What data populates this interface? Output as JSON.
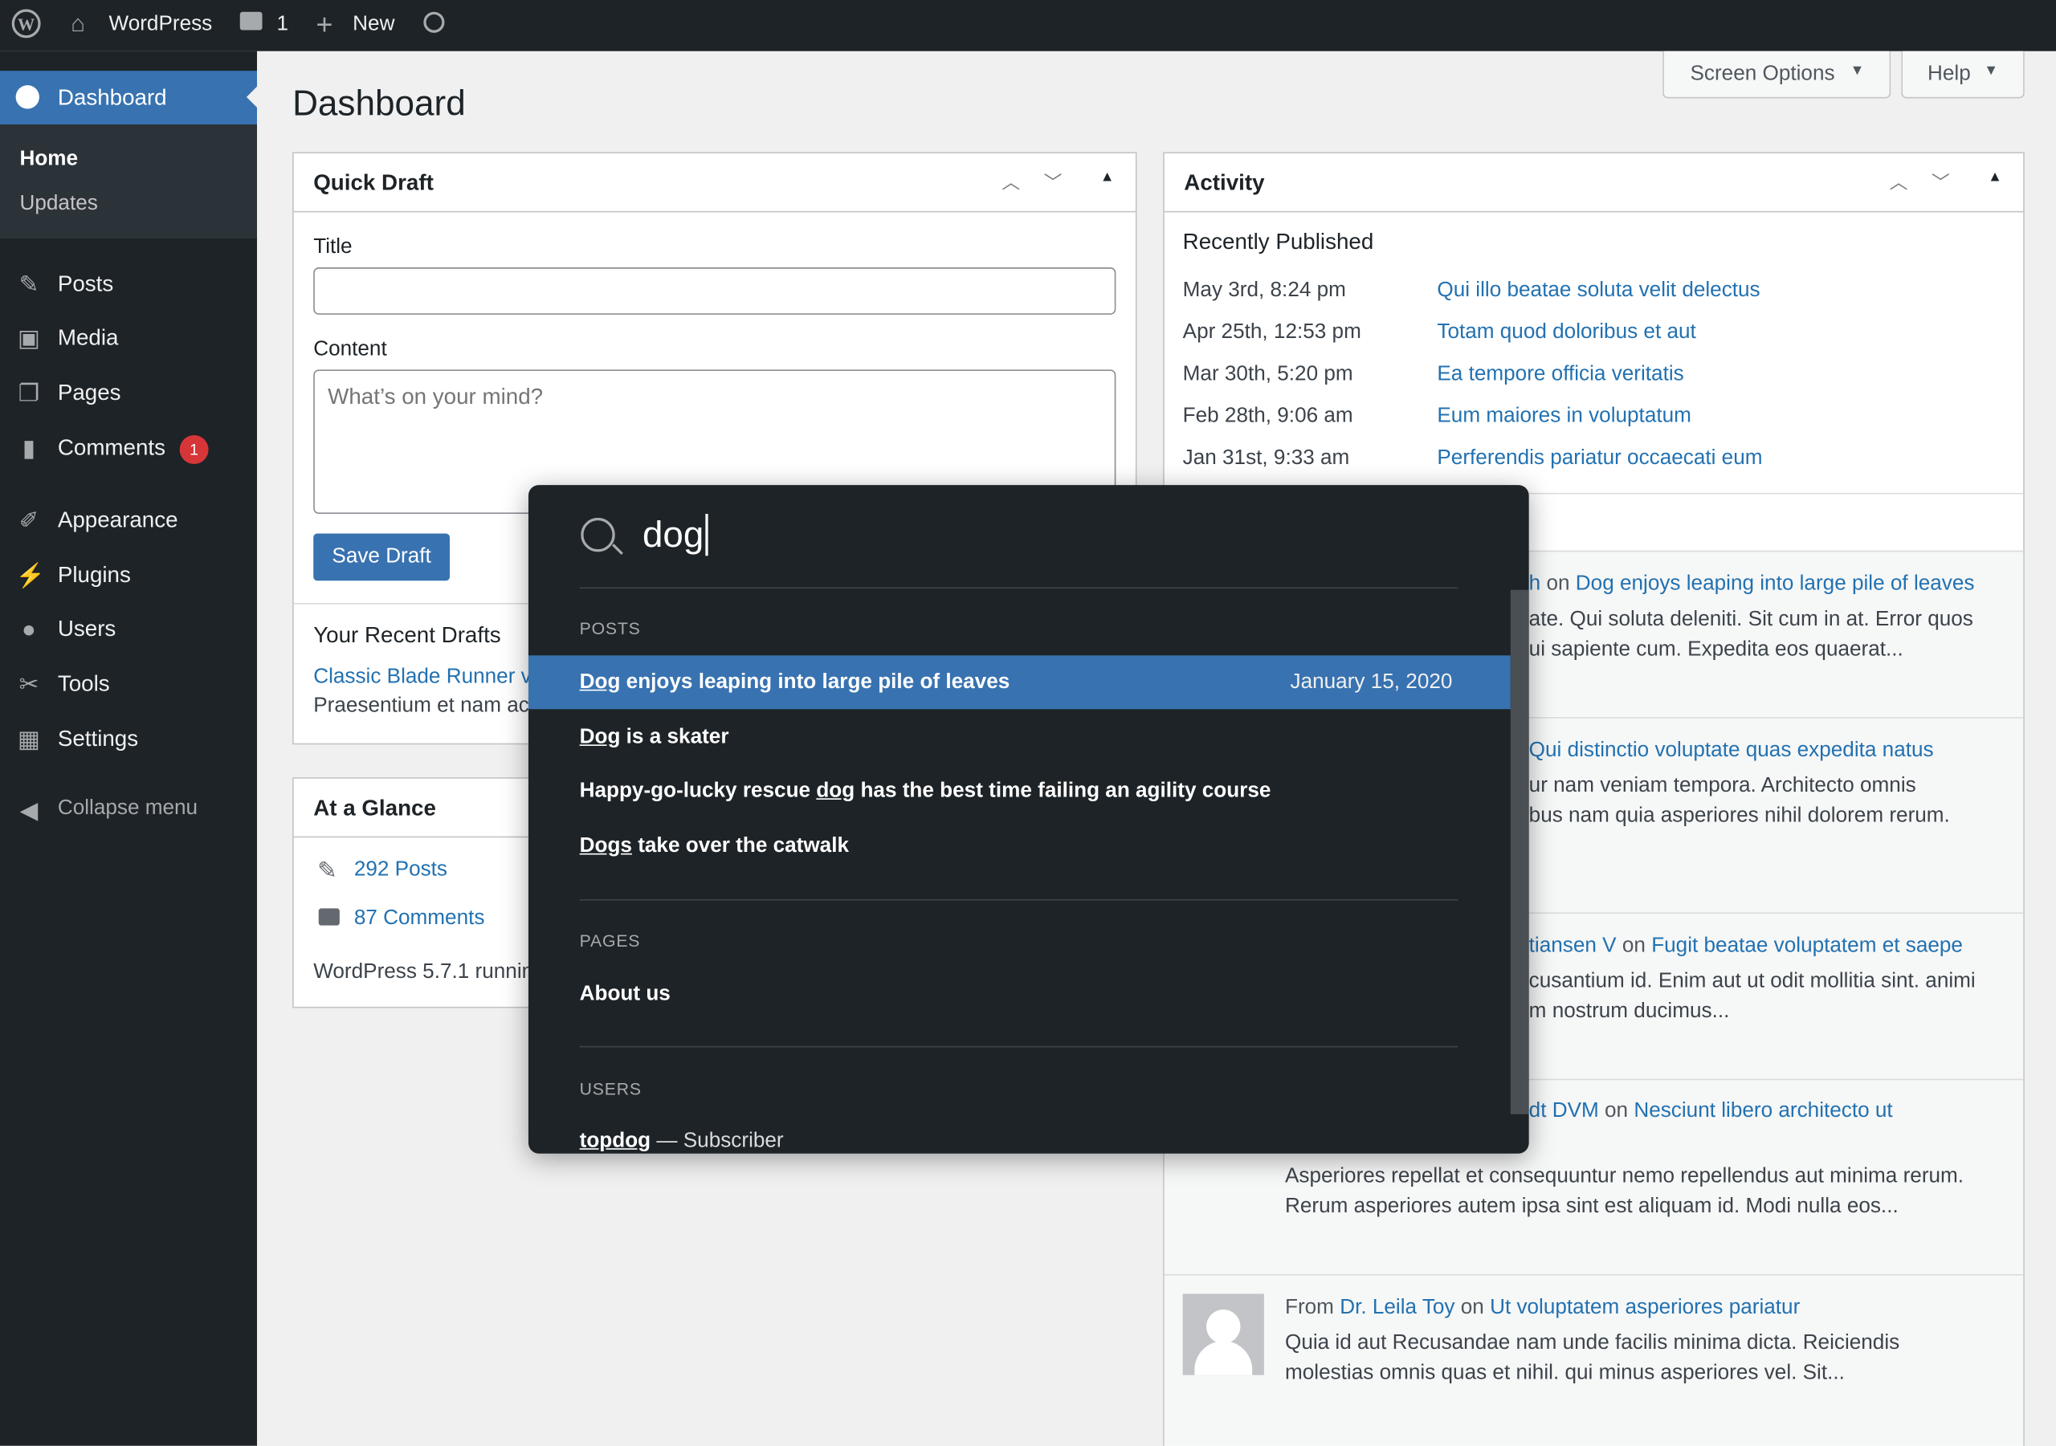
{
  "admin_bar": {
    "site_name": "WordPress",
    "comment_count": "1",
    "new_label": "New"
  },
  "sidebar": {
    "dashboard": "Dashboard",
    "home": "Home",
    "updates": "Updates",
    "items": [
      {
        "label": "Posts",
        "icon": "pin-icon"
      },
      {
        "label": "Media",
        "icon": "media-icon"
      },
      {
        "label": "Pages",
        "icon": "pages-icon"
      },
      {
        "label": "Comments",
        "icon": "comment-icon",
        "badge": "1"
      },
      {
        "label": "Appearance",
        "icon": "brush-icon"
      },
      {
        "label": "Plugins",
        "icon": "plug-icon"
      },
      {
        "label": "Users",
        "icon": "user-icon"
      },
      {
        "label": "Tools",
        "icon": "wrench-icon"
      },
      {
        "label": "Settings",
        "icon": "settings-icon"
      }
    ],
    "collapse": "Collapse menu"
  },
  "header": {
    "title": "Dashboard",
    "screen_options": "Screen Options",
    "help": "Help"
  },
  "quick_draft": {
    "title": "Quick Draft",
    "title_label": "Title",
    "title_value": "",
    "content_label": "Content",
    "content_placeholder": "What’s on your mind?",
    "save": "Save Draft",
    "recent_heading": "Your Recent Drafts",
    "draft_link": "Classic Blade Runner v",
    "draft_excerpt": "Praesentium et nam ac"
  },
  "glance": {
    "title": "At a Glance",
    "posts": "292 Posts",
    "comments": "87 Comments",
    "version": "WordPress 5.7.1 runnin"
  },
  "activity": {
    "title": "Activity",
    "recent_heading": "Recently Published",
    "published": [
      {
        "date": "May 3rd, 8:24 pm",
        "title": "Qui illo beatae soluta velit delectus"
      },
      {
        "date": "Apr 25th, 12:53 pm",
        "title": "Totam quod doloribus et aut"
      },
      {
        "date": "Mar 30th, 5:20 pm",
        "title": "Ea tempore officia veritatis"
      },
      {
        "date": "Feb 28th, 9:06 am",
        "title": "Eum maiores in voluptatum"
      },
      {
        "date": "Jan 31st, 9:33 am",
        "title": "Perferendis pariatur occaecati eum"
      }
    ],
    "comments": [
      {
        "author": "h",
        "post": "Dog enjoys leaping into large pile of leaves",
        "line1": "ate. Qui soluta deleniti. Sit cum in at. Error quos",
        "line2": "ui sapiente cum. Expedita eos quaerat..."
      },
      {
        "author": "",
        "post": "Qui distinctio voluptate quas expedita natus",
        "line1": "ur nam veniam tempora. Architecto omnis",
        "line2": "bus nam quia asperiores nihil dolorem rerum."
      },
      {
        "author": "tiansen V",
        "post": "Fugit beatae voluptatem et saepe",
        "line1": "cusantium id. Enim aut ut odit mollitia sint. animi",
        "line2": "m nostrum ducimus..."
      },
      {
        "author": "dt DVM",
        "post": "Nesciunt libero architecto ut",
        "line1": "Asperiores repellat et consequuntur nemo repellendus aut minima rerum.",
        "line2": "Rerum asperiores autem ipsa sint est aliquam id. Modi nulla eos..."
      },
      {
        "from": "From",
        "author": "Dr. Leila Toy",
        "post": "Ut voluptatem asperiores pariatur",
        "line1": "Quia id aut Recusandae nam unde facilis minima dicta. Reiciendis",
        "line2": "molestias omnis quas et nihil. qui minus asperiores vel. Sit..."
      }
    ],
    "on": "on"
  },
  "search": {
    "query": "dog",
    "posts_heading": "POSTS",
    "posts": [
      {
        "match": "Dog",
        "rest": " enjoys leaping into large pile of leaves",
        "date": "January 15, 2020"
      },
      {
        "match": "Dog",
        "rest": " is a skater"
      },
      {
        "pre": "Happy-go-lucky rescue ",
        "match": "dog",
        "rest": " has the best time failing an agility course"
      },
      {
        "match": "Dogs",
        "rest": " take over the catwalk"
      }
    ],
    "pages_heading": "PAGES",
    "pages": [
      "About us"
    ],
    "users_heading": "USERS",
    "users": [
      {
        "name": "topdog",
        "role": " — Subscriber"
      }
    ]
  },
  "colors": {
    "admin_dark": "#1d2327",
    "accent": "#2271b1",
    "highlight": "#3872b0",
    "badge": "#d63638"
  }
}
